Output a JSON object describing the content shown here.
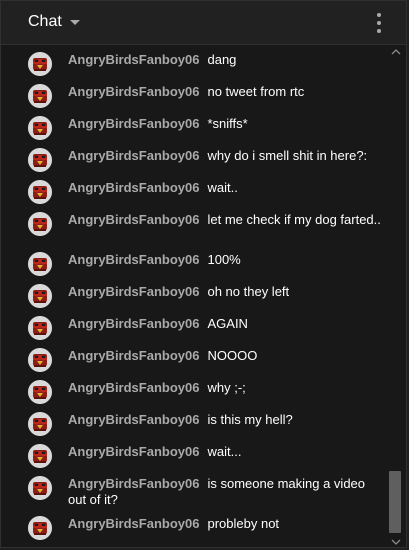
{
  "header": {
    "title": "Chat",
    "dropdown_icon": "caret-down-icon",
    "menu_icon": "more-vert-icon"
  },
  "colors": {
    "panel_bg": "#181818",
    "header_bg": "#212121",
    "author_color": "#aaaaaa",
    "message_color": "#ffffff",
    "scroll_thumb": "#5f5f5f"
  },
  "messages": [
    {
      "author": "AngryBirdsFanboy06",
      "text": "dang"
    },
    {
      "author": "AngryBirdsFanboy06",
      "text": "no tweet from rtc"
    },
    {
      "author": "AngryBirdsFanboy06",
      "text": "*sniffs*"
    },
    {
      "author": "AngryBirdsFanboy06",
      "text": "why do i smell shit in here?:"
    },
    {
      "author": "AngryBirdsFanboy06",
      "text": "wait.."
    },
    {
      "author": "AngryBirdsFanboy06",
      "text": "let me check if my dog farted.."
    },
    {
      "author": "AngryBirdsFanboy06",
      "text": "100%"
    },
    {
      "author": "AngryBirdsFanboy06",
      "text": "oh no they left"
    },
    {
      "author": "AngryBirdsFanboy06",
      "text": "AGAIN"
    },
    {
      "author": "AngryBirdsFanboy06",
      "text": "NOOOO"
    },
    {
      "author": "AngryBirdsFanboy06",
      "text": "why ;-;"
    },
    {
      "author": "AngryBirdsFanboy06",
      "text": "is this my hell?"
    },
    {
      "author": "AngryBirdsFanboy06",
      "text": "wait..."
    },
    {
      "author": "AngryBirdsFanboy06",
      "text": "is someone making a video out of it?"
    },
    {
      "author": "AngryBirdsFanboy06",
      "text": "probleby not"
    }
  ]
}
